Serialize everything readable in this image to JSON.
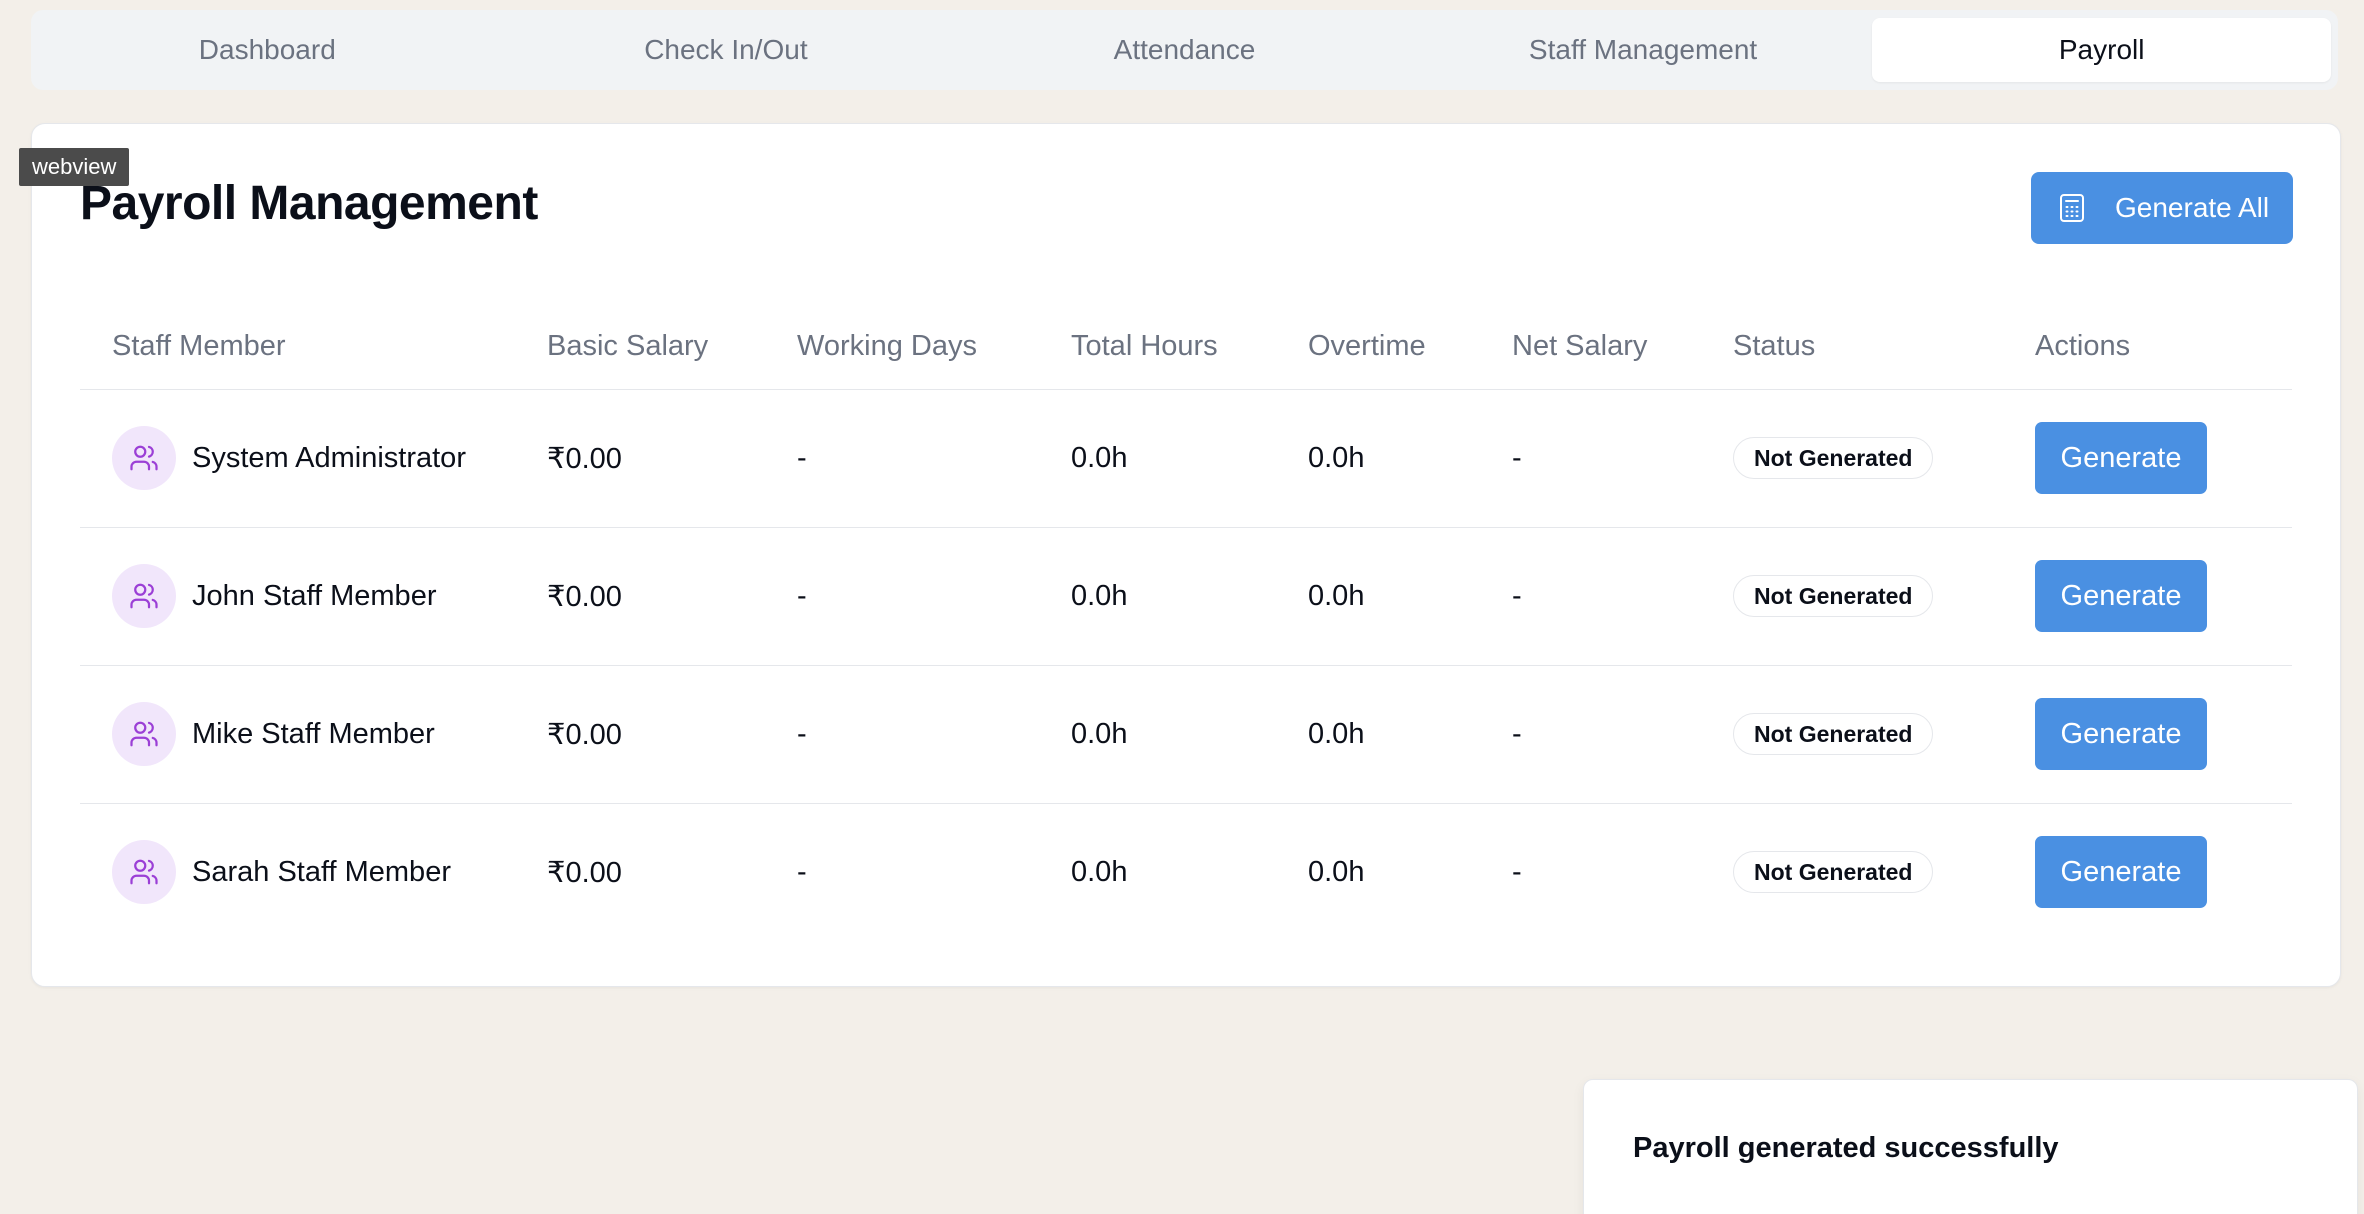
{
  "tabs": [
    {
      "label": "Dashboard",
      "active": false
    },
    {
      "label": "Check In/Out",
      "active": false
    },
    {
      "label": "Attendance",
      "active": false
    },
    {
      "label": "Staff Management",
      "active": false
    },
    {
      "label": "Payroll",
      "active": true
    }
  ],
  "webview_tag": "webview",
  "page": {
    "title": "Payroll Management",
    "generate_all_label": "Generate All",
    "generate_all_icon": "calculator-icon"
  },
  "table": {
    "headers": [
      "Staff Member",
      "Basic Salary",
      "Working Days",
      "Total Hours",
      "Overtime",
      "Net Salary",
      "Status",
      "Actions"
    ],
    "rows": [
      {
        "name": "System Administrator",
        "basic_salary": "₹0.00",
        "working_days": "-",
        "total_hours": "0.0h",
        "overtime": "0.0h",
        "net_salary": "-",
        "status": "Not Generated",
        "action": "Generate"
      },
      {
        "name": "John Staff Member",
        "basic_salary": "₹0.00",
        "working_days": "-",
        "total_hours": "0.0h",
        "overtime": "0.0h",
        "net_salary": "-",
        "status": "Not Generated",
        "action": "Generate"
      },
      {
        "name": "Mike Staff Member",
        "basic_salary": "₹0.00",
        "working_days": "-",
        "total_hours": "0.0h",
        "overtime": "0.0h",
        "net_salary": "-",
        "status": "Not Generated",
        "action": "Generate"
      },
      {
        "name": "Sarah Staff Member",
        "basic_salary": "₹0.00",
        "working_days": "-",
        "total_hours": "0.0h",
        "overtime": "0.0h",
        "net_salary": "-",
        "status": "Not Generated",
        "action": "Generate"
      }
    ],
    "avatar_icon": "users-icon"
  },
  "toast": {
    "message": "Payroll generated successfully"
  },
  "colors": {
    "accent": "#4a90e2",
    "avatar_bg": "#f1e6fb",
    "avatar_icon": "#9b3fd6",
    "page_bg": "#f3efe9"
  }
}
